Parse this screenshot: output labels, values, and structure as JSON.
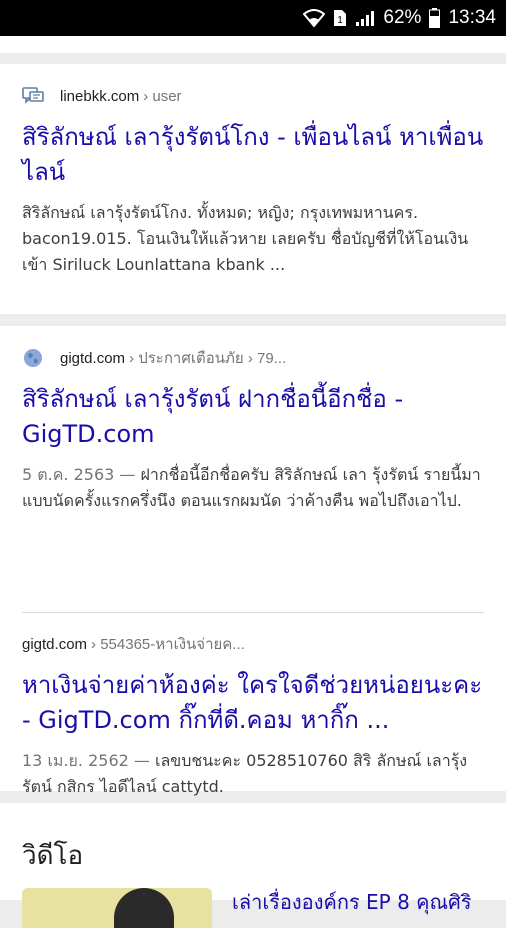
{
  "status_bar": {
    "battery": "62%",
    "time": "13:34"
  },
  "results": [
    {
      "site": "linebkk.com",
      "path": "› user",
      "title": "สิริลักษณ์ เลารุ้งรัตน์โกง - เพื่อนไลน์ หาเพื่อนไลน์",
      "snippet": "สิริลักษณ์ เลารุ้งรัตน์โกง. ทั้งหมด; หญิง; กรุงเทพมหานคร. bacon19.015. โอนเงินให้แล้วหาย เลยครับ ชื่อบัญชีที่ให้โอนเงินเข้า Siriluck Lounlattana kbank ..."
    },
    {
      "site": "gigtd.com",
      "path": "› ประกาศเตือนภัย › 79...",
      "title": "สิริลักษณ์ เลารุ้งรัตน์ ฝากชื่อนี้อีกชื่อ - GigTD.com",
      "date": "5 ต.ค. 2563 —",
      "snippet": "ฝากชื่อนี้อีกชื่อครับ สิริลักษณ์ เลา รุ้งรัตน์ รายนี้มาแบบนัดครั้งแรกครึ่งนึง ตอนแรกผมนัด ว่าค้างคืน พอไปถึงเอาไป."
    },
    {
      "site": "gigtd.com",
      "path": "› 554365-หาเงินจ่ายค...",
      "title": "หาเงินจ่ายค่าห้องค่ะ ใครใจดีช่วยหน่อยนะคะ - GigTD.com กิ๊กที่ดี.คอม หากิ๊ก ...",
      "date": "13 เม.ย. 2562 —",
      "snippet": "เลขบชนะคะ 0528510760 สิริ ลักษณ์ เลารุ้งรัตน์ กสิกร ไอดีไลน์ cattytd."
    }
  ],
  "videos": {
    "heading": "วิดีโอ",
    "first_title": "เล่าเรื่ององค์กร EP 8 คุณศิริ"
  }
}
